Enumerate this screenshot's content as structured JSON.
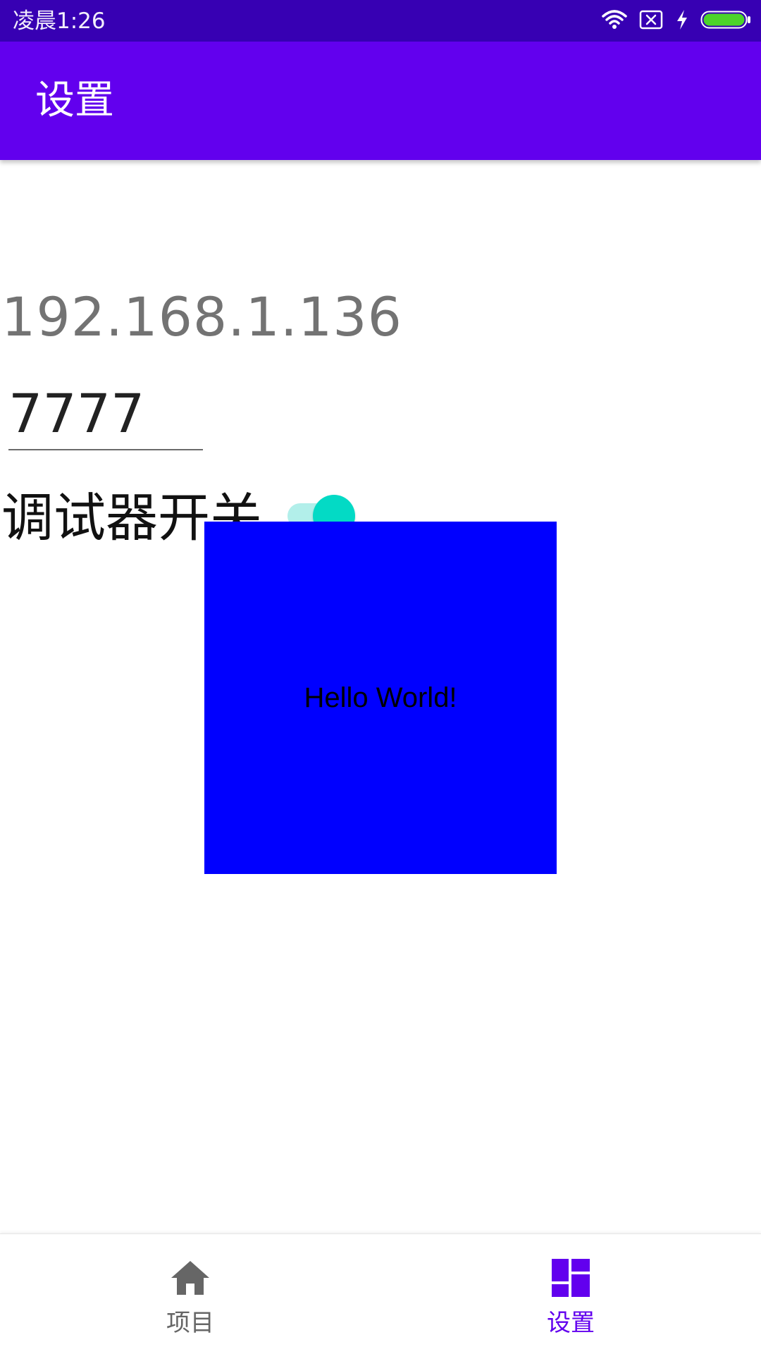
{
  "status_bar": {
    "time": "凌晨1:26",
    "icons": [
      "wifi-icon",
      "sim-error-icon",
      "charging-bolt-icon",
      "battery-icon"
    ],
    "battery_color": "#4cd42a"
  },
  "app_bar": {
    "title": "设置",
    "color": "#6200EE"
  },
  "settings": {
    "ip_address": "192.168.1.136",
    "port_value": "7777",
    "debug_switch_label": "调试器开关",
    "debug_switch_on": true,
    "switch_accent": "#03DAC5"
  },
  "overlay": {
    "text": "Hello World!",
    "color": "#0000FF"
  },
  "bottom_nav": {
    "items": [
      {
        "label": "项目",
        "icon": "home-icon",
        "active": false
      },
      {
        "label": "设置",
        "icon": "dashboard-icon",
        "active": true
      }
    ],
    "active_color": "#6200EE",
    "inactive_color": "#666666"
  }
}
